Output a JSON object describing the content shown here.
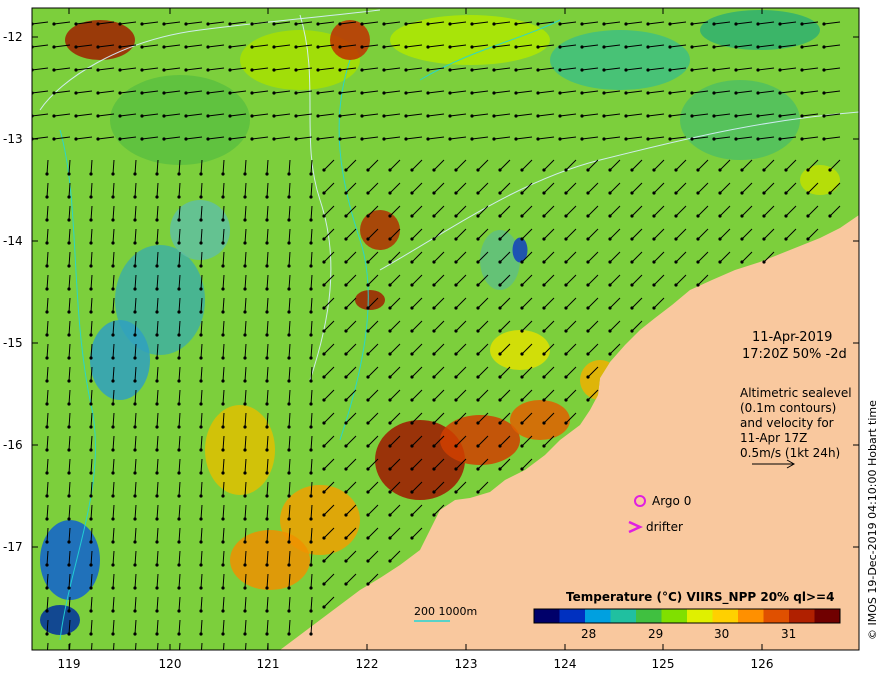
{
  "map": {
    "lon_ticks": [
      "119",
      "120",
      "121",
      "122",
      "123",
      "124",
      "125",
      "126"
    ],
    "lat_ticks": [
      "-12",
      "-13",
      "-14",
      "-15",
      "-16",
      "-17"
    ],
    "colors": {
      "land": "#f9c89e",
      "frame": "#000000",
      "contour": "#d8f0ff",
      "bathy_contour": "#22d6d6",
      "argo_marker": "#e020e0",
      "drifter_marker": "#e020e0"
    }
  },
  "annotations": {
    "date": "11-Apr-2019",
    "time": "17:20Z  50% -2d",
    "desc_line1": "Altimetric sealevel",
    "desc_line2": "(0.1m contours)",
    "desc_line3": "and velocity for",
    "desc_line4": "11-Apr 17Z",
    "desc_line5": "0.5m/s (1kt 24h)",
    "argo_label": "Argo 0",
    "drifter_label": "drifter",
    "bathy_label": "200  1000m"
  },
  "colorbar": {
    "title": "Temperature (°C) VIIRS_NPP 20% ql>=4",
    "ticks": [
      "28",
      "29",
      "30",
      "31"
    ],
    "colors": [
      "#00006a",
      "#0030c0",
      "#00a0e0",
      "#20c0a0",
      "#40c040",
      "#80e000",
      "#e0f000",
      "#ffd000",
      "#ff9000",
      "#e05000",
      "#b02000",
      "#700000"
    ]
  },
  "credit": "© IMOS 19-Dec-2019 04:10:00 Hobart time"
}
